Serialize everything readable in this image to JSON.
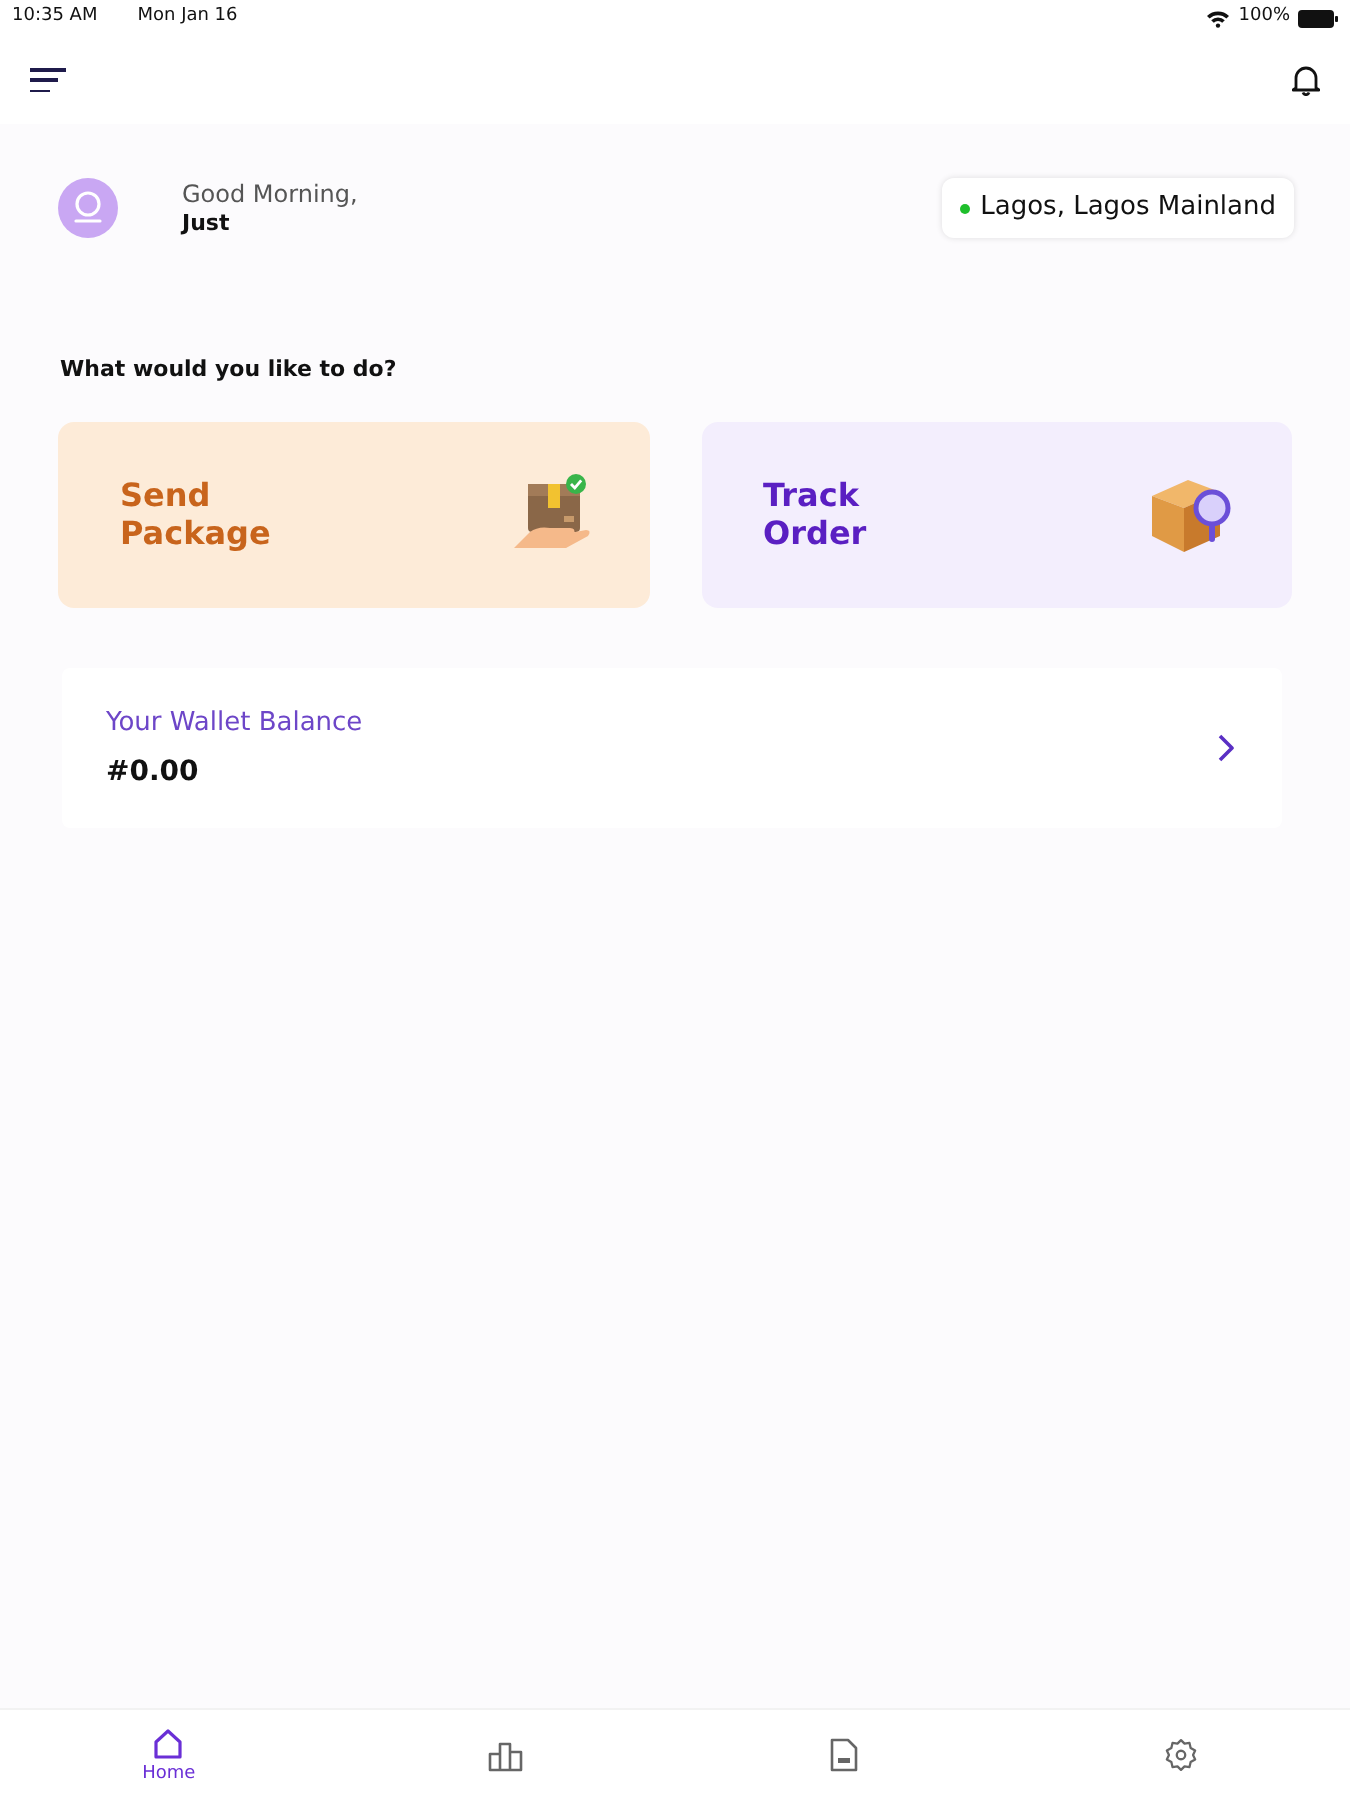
{
  "status_bar": {
    "time": "10:35 AM",
    "date": "Mon Jan 16",
    "battery": "100%"
  },
  "greeting": {
    "salutation": "Good Morning,",
    "name": "Just"
  },
  "location": {
    "label": "Lagos, Lagos Mainland"
  },
  "prompt": "What would you like to do?",
  "actions": [
    {
      "kind": "send",
      "label": "Send Package"
    },
    {
      "kind": "track",
      "label": "Track Order"
    }
  ],
  "wallet": {
    "label": "Your Wallet Balance",
    "amount": "#0.00"
  },
  "bottom_nav": [
    {
      "kind": "home",
      "label": "Home",
      "selected": true
    },
    {
      "kind": "stats",
      "selected": false
    },
    {
      "kind": "document",
      "selected": false
    },
    {
      "kind": "settings",
      "selected": false
    }
  ]
}
